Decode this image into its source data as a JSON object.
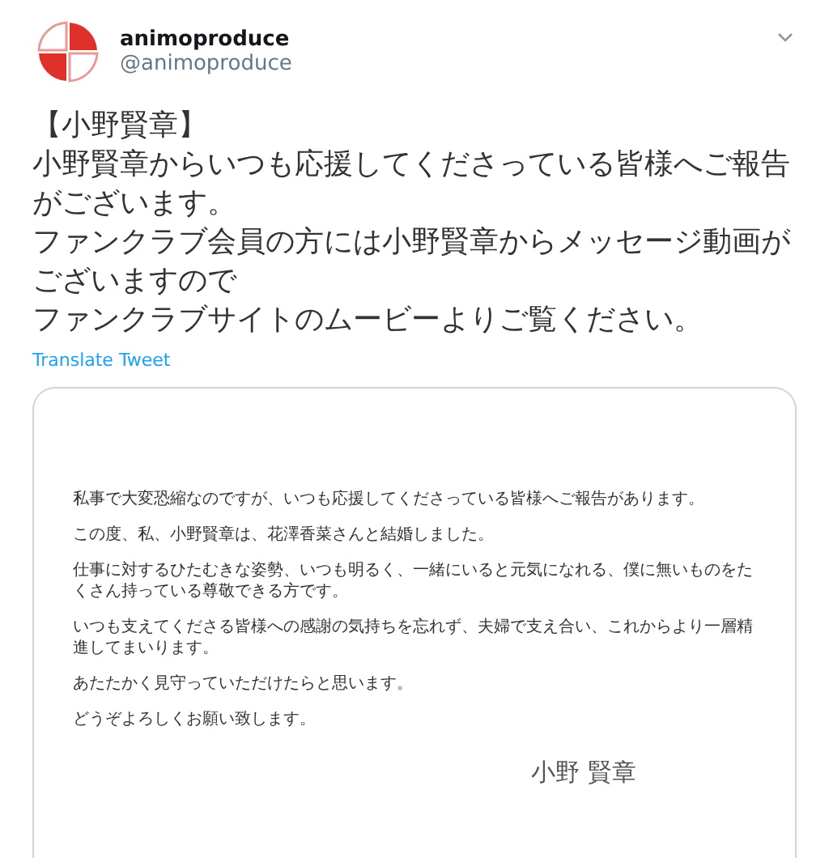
{
  "tweet": {
    "author_name": "animoproduce",
    "handle": "@animoproduce",
    "text_lines": [
      "【小野賢章】",
      "小野賢章からいつも応援してくださっている皆様へご報告がございます。",
      "ファンクラブ会員の方には小野賢章からメッセージ動画がございますので",
      "ファンクラブサイトのムービーよりご覧ください。"
    ],
    "translate_link": "Translate Tweet",
    "attachment": {
      "kind": "document",
      "paragraphs": [
        "私事で大変恐縮なのですが、いつも応援してくださっている皆様へご報告があります。",
        "この度、私、小野賢章は、花澤香菜さんと結婚しました。",
        "仕事に対するひたむきな姿勢、いつも明るく、一緒にいると元気になれる、僕に無いものをたくさん持っている尊敬できる方です。",
        "いつも支えてくださる皆様への感謝の気持ちを忘れず、夫婦で支え合い、これからより一層精進してまいります。",
        "あたたかく見守っていただけたらと思います。",
        "どうぞよろしくお願い致します。"
      ],
      "signature": "小野 賢章"
    }
  }
}
